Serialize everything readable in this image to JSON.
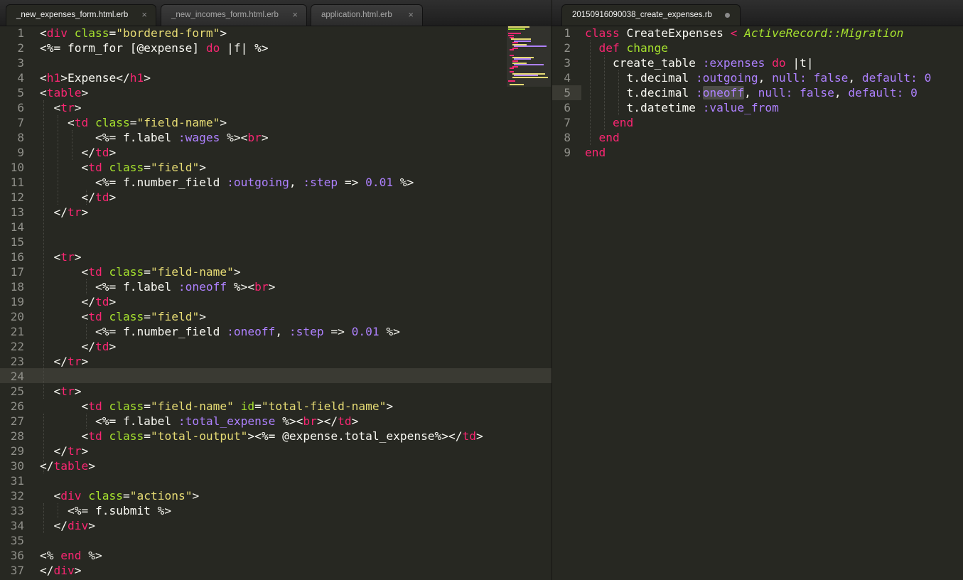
{
  "left_pane": {
    "tabs": [
      {
        "label": "_new_expenses_form.html.erb",
        "close_glyph": "×",
        "active": true
      },
      {
        "label": "_new_incomes_form.html.erb",
        "close_glyph": "×",
        "active": false
      },
      {
        "label": "application.html.erb",
        "close_glyph": "×",
        "active": false
      }
    ],
    "line_numbers": [
      "1",
      "2",
      "3",
      "4",
      "5",
      "6",
      "7",
      "8",
      "9",
      "10",
      "11",
      "12",
      "13",
      "14",
      "15",
      "16",
      "17",
      "18",
      "19",
      "20",
      "21",
      "22",
      "23",
      "24",
      "25",
      "26",
      "27",
      "28",
      "29",
      "30",
      "31",
      "32",
      "33",
      "34",
      "35",
      "36",
      "37"
    ],
    "current_line": 24,
    "lines": [
      [
        {
          "c": "pl",
          "t": "<"
        },
        {
          "c": "tag",
          "t": "div"
        },
        {
          "c": "pl",
          "t": " "
        },
        {
          "c": "attr",
          "t": "class"
        },
        {
          "c": "pl",
          "t": "="
        },
        {
          "c": "str",
          "t": "\"bordered-form\""
        },
        {
          "c": "pl",
          "t": ">"
        }
      ],
      [
        {
          "c": "pl",
          "t": "<%= form_for [@expense] "
        },
        {
          "c": "kw",
          "t": "do"
        },
        {
          "c": "pl",
          "t": " |f| %>"
        }
      ],
      [],
      [
        {
          "c": "pl",
          "t": "<"
        },
        {
          "c": "tag",
          "t": "h1"
        },
        {
          "c": "pl",
          "t": ">Expense</"
        },
        {
          "c": "tag",
          "t": "h1"
        },
        {
          "c": "pl",
          "t": ">"
        }
      ],
      [
        {
          "c": "pl",
          "t": "<"
        },
        {
          "c": "tag",
          "t": "table"
        },
        {
          "c": "pl",
          "t": ">"
        }
      ],
      [
        {
          "c": "pl",
          "t": "  <"
        },
        {
          "c": "tag",
          "t": "tr"
        },
        {
          "c": "pl",
          "t": ">"
        }
      ],
      [
        {
          "c": "pl",
          "t": "    <"
        },
        {
          "c": "tag",
          "t": "td"
        },
        {
          "c": "pl",
          "t": " "
        },
        {
          "c": "attr",
          "t": "class"
        },
        {
          "c": "pl",
          "t": "="
        },
        {
          "c": "str",
          "t": "\"field-name\""
        },
        {
          "c": "pl",
          "t": ">"
        }
      ],
      [
        {
          "c": "pl",
          "t": "        <%= f.label "
        },
        {
          "c": "sym",
          "t": ":wages"
        },
        {
          "c": "pl",
          "t": " %><"
        },
        {
          "c": "tag",
          "t": "br"
        },
        {
          "c": "pl",
          "t": ">"
        }
      ],
      [
        {
          "c": "pl",
          "t": "      </"
        },
        {
          "c": "tag",
          "t": "td"
        },
        {
          "c": "pl",
          "t": ">"
        }
      ],
      [
        {
          "c": "pl",
          "t": "      <"
        },
        {
          "c": "tag",
          "t": "td"
        },
        {
          "c": "pl",
          "t": " "
        },
        {
          "c": "attr",
          "t": "class"
        },
        {
          "c": "pl",
          "t": "="
        },
        {
          "c": "str",
          "t": "\"field\""
        },
        {
          "c": "pl",
          "t": ">"
        }
      ],
      [
        {
          "c": "pl",
          "t": "        <%= f.number_field "
        },
        {
          "c": "sym",
          "t": ":outgoing"
        },
        {
          "c": "pl",
          "t": ", "
        },
        {
          "c": "sym",
          "t": ":step"
        },
        {
          "c": "pl",
          "t": " => "
        },
        {
          "c": "num",
          "t": "0.01"
        },
        {
          "c": "pl",
          "t": " %>"
        }
      ],
      [
        {
          "c": "pl",
          "t": "      </"
        },
        {
          "c": "tag",
          "t": "td"
        },
        {
          "c": "pl",
          "t": ">"
        }
      ],
      [
        {
          "c": "pl",
          "t": "  </"
        },
        {
          "c": "tag",
          "t": "tr"
        },
        {
          "c": "pl",
          "t": ">"
        }
      ],
      [],
      [],
      [
        {
          "c": "pl",
          "t": "  <"
        },
        {
          "c": "tag",
          "t": "tr"
        },
        {
          "c": "pl",
          "t": ">"
        }
      ],
      [
        {
          "c": "pl",
          "t": "      <"
        },
        {
          "c": "tag",
          "t": "td"
        },
        {
          "c": "pl",
          "t": " "
        },
        {
          "c": "attr",
          "t": "class"
        },
        {
          "c": "pl",
          "t": "="
        },
        {
          "c": "str",
          "t": "\"field-name\""
        },
        {
          "c": "pl",
          "t": ">"
        }
      ],
      [
        {
          "c": "pl",
          "t": "        <%= f.label "
        },
        {
          "c": "sym",
          "t": ":oneoff"
        },
        {
          "c": "pl",
          "t": " %><"
        },
        {
          "c": "tag",
          "t": "br"
        },
        {
          "c": "pl",
          "t": ">"
        }
      ],
      [
        {
          "c": "pl",
          "t": "      </"
        },
        {
          "c": "tag",
          "t": "td"
        },
        {
          "c": "pl",
          "t": ">"
        }
      ],
      [
        {
          "c": "pl",
          "t": "      <"
        },
        {
          "c": "tag",
          "t": "td"
        },
        {
          "c": "pl",
          "t": " "
        },
        {
          "c": "attr",
          "t": "class"
        },
        {
          "c": "pl",
          "t": "="
        },
        {
          "c": "str",
          "t": "\"field\""
        },
        {
          "c": "pl",
          "t": ">"
        }
      ],
      [
        {
          "c": "pl",
          "t": "        <%= f.number_field "
        },
        {
          "c": "sym",
          "t": ":oneoff"
        },
        {
          "c": "pl",
          "t": ", "
        },
        {
          "c": "sym",
          "t": ":step"
        },
        {
          "c": "pl",
          "t": " => "
        },
        {
          "c": "num",
          "t": "0.01"
        },
        {
          "c": "pl",
          "t": " %>"
        }
      ],
      [
        {
          "c": "pl",
          "t": "      </"
        },
        {
          "c": "tag",
          "t": "td"
        },
        {
          "c": "pl",
          "t": ">"
        }
      ],
      [
        {
          "c": "pl",
          "t": "  </"
        },
        {
          "c": "tag",
          "t": "tr"
        },
        {
          "c": "pl",
          "t": ">"
        }
      ],
      [],
      [
        {
          "c": "pl",
          "t": "  <"
        },
        {
          "c": "tag",
          "t": "tr"
        },
        {
          "c": "pl",
          "t": ">"
        }
      ],
      [
        {
          "c": "pl",
          "t": "      <"
        },
        {
          "c": "tag",
          "t": "td"
        },
        {
          "c": "pl",
          "t": " "
        },
        {
          "c": "attr",
          "t": "class"
        },
        {
          "c": "pl",
          "t": "="
        },
        {
          "c": "str",
          "t": "\"field-name\""
        },
        {
          "c": "pl",
          "t": " "
        },
        {
          "c": "attr",
          "t": "id"
        },
        {
          "c": "pl",
          "t": "="
        },
        {
          "c": "str",
          "t": "\"total-field-name\""
        },
        {
          "c": "pl",
          "t": ">"
        }
      ],
      [
        {
          "c": "pl",
          "t": "        <%= f.label "
        },
        {
          "c": "sym",
          "t": ":total_expense"
        },
        {
          "c": "pl",
          "t": " %><"
        },
        {
          "c": "tag",
          "t": "br"
        },
        {
          "c": "pl",
          "t": "></"
        },
        {
          "c": "tag",
          "t": "td"
        },
        {
          "c": "pl",
          "t": ">"
        }
      ],
      [
        {
          "c": "pl",
          "t": "      <"
        },
        {
          "c": "tag",
          "t": "td"
        },
        {
          "c": "pl",
          "t": " "
        },
        {
          "c": "attr",
          "t": "class"
        },
        {
          "c": "pl",
          "t": "="
        },
        {
          "c": "str",
          "t": "\"total-output\""
        },
        {
          "c": "pl",
          "t": "><%= @expense.total_expense%></"
        },
        {
          "c": "tag",
          "t": "td"
        },
        {
          "c": "pl",
          "t": ">"
        }
      ],
      [
        {
          "c": "pl",
          "t": "  </"
        },
        {
          "c": "tag",
          "t": "tr"
        },
        {
          "c": "pl",
          "t": ">"
        }
      ],
      [
        {
          "c": "pl",
          "t": "</"
        },
        {
          "c": "tag",
          "t": "table"
        },
        {
          "c": "pl",
          "t": ">"
        }
      ],
      [],
      [
        {
          "c": "pl",
          "t": "  <"
        },
        {
          "c": "tag",
          "t": "div"
        },
        {
          "c": "pl",
          "t": " "
        },
        {
          "c": "attr",
          "t": "class"
        },
        {
          "c": "pl",
          "t": "="
        },
        {
          "c": "str",
          "t": "\"actions\""
        },
        {
          "c": "pl",
          "t": ">"
        }
      ],
      [
        {
          "c": "pl",
          "t": "    <%= f.submit %>"
        }
      ],
      [
        {
          "c": "pl",
          "t": "  </"
        },
        {
          "c": "tag",
          "t": "div"
        },
        {
          "c": "pl",
          "t": ">"
        }
      ],
      [],
      [
        {
          "c": "pl",
          "t": "<% "
        },
        {
          "c": "kw",
          "t": "end"
        },
        {
          "c": "pl",
          "t": " %>"
        }
      ],
      [
        {
          "c": "pl",
          "t": "</"
        },
        {
          "c": "tag",
          "t": "div"
        },
        {
          "c": "pl",
          "t": ">"
        }
      ]
    ]
  },
  "right_pane": {
    "tabs": [
      {
        "label": "20150916090038_create_expenses.rb",
        "dirty": true,
        "active": true
      }
    ],
    "line_numbers": [
      "1",
      "2",
      "3",
      "4",
      "5",
      "6",
      "7",
      "8",
      "9"
    ],
    "current_line": 5,
    "lines": [
      [
        {
          "c": "kw",
          "t": "class"
        },
        {
          "c": "pl",
          "t": " CreateExpenses "
        },
        {
          "c": "kw",
          "t": "<"
        },
        {
          "c": "pl",
          "t": " "
        },
        {
          "c": "cls",
          "t": "ActiveRecord::Migration"
        }
      ],
      [
        {
          "c": "pl",
          "t": "  "
        },
        {
          "c": "kw",
          "t": "def"
        },
        {
          "c": "pl",
          "t": " "
        },
        {
          "c": "fn",
          "t": "change"
        }
      ],
      [
        {
          "c": "pl",
          "t": "    create_table "
        },
        {
          "c": "sym",
          "t": ":expenses"
        },
        {
          "c": "pl",
          "t": " "
        },
        {
          "c": "kw",
          "t": "do"
        },
        {
          "c": "pl",
          "t": " |t|"
        }
      ],
      [
        {
          "c": "pl",
          "t": "      t.decimal "
        },
        {
          "c": "sym",
          "t": ":outgoing"
        },
        {
          "c": "pl",
          "t": ", "
        },
        {
          "c": "sym",
          "t": "null:"
        },
        {
          "c": "pl",
          "t": " "
        },
        {
          "c": "num",
          "t": "false"
        },
        {
          "c": "pl",
          "t": ", "
        },
        {
          "c": "sym",
          "t": "default:"
        },
        {
          "c": "pl",
          "t": " "
        },
        {
          "c": "num",
          "t": "0"
        }
      ],
      [
        {
          "c": "pl",
          "t": "      t.decimal "
        },
        {
          "c": "sym",
          "t": ":"
        },
        {
          "c": "sym",
          "sel": true,
          "t": "oneoff"
        },
        {
          "c": "pl",
          "t": ", "
        },
        {
          "c": "sym",
          "t": "null:"
        },
        {
          "c": "pl",
          "t": " "
        },
        {
          "c": "num",
          "t": "false"
        },
        {
          "c": "pl",
          "t": ", "
        },
        {
          "c": "sym",
          "t": "default:"
        },
        {
          "c": "pl",
          "t": " "
        },
        {
          "c": "num",
          "t": "0"
        }
      ],
      [
        {
          "c": "pl",
          "t": "      t.datetime "
        },
        {
          "c": "sym",
          "t": ":value_from"
        }
      ],
      [
        {
          "c": "pl",
          "t": "    "
        },
        {
          "c": "kw",
          "t": "end"
        }
      ],
      [
        {
          "c": "pl",
          "t": "  "
        },
        {
          "c": "kw",
          "t": "end"
        }
      ],
      [
        {
          "c": "kw",
          "t": "end"
        }
      ]
    ]
  },
  "colors": {
    "background": "#272822",
    "foreground": "#f8f8f2",
    "tag": "#f92672",
    "attribute": "#a6e22e",
    "string": "#e6db74",
    "symbol": "#ae81ff",
    "line_number": "#90908a"
  }
}
